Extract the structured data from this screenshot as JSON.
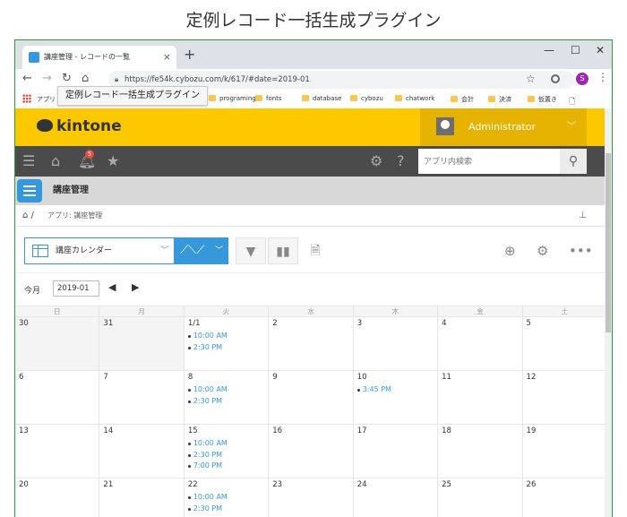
{
  "caption": "定例レコード一括生成プラグイン",
  "browser": {
    "tab_title": "講座管理 - レコードの一覧",
    "tab_close": "×",
    "new_tab": "+",
    "url": "https://fe54k.cybozu.com/k/617/#date=2019-01",
    "bookmarks": [
      "アプリ",
      "programing",
      "fonts",
      "database",
      "cybozu",
      "chatwork",
      "会計",
      "決済",
      "仮置き"
    ],
    "tooltip": "定例レコード一括生成プラグイン",
    "profile_initial": "S"
  },
  "header": {
    "logo": "kintone",
    "user": "Administrator"
  },
  "nav": {
    "notification_count": "5",
    "search_placeholder": "アプリ内検索"
  },
  "app": {
    "name": "講座管理",
    "breadcrumb": "アプリ: 講座管理"
  },
  "toolbar": {
    "view_name": "講座カレンダー"
  },
  "calendar": {
    "today_label": "今月",
    "month_value": "2019-01",
    "weekdays": [
      "日",
      "月",
      "火",
      "水",
      "木",
      "金",
      "土"
    ],
    "weeks": [
      [
        {
          "d": "30",
          "prev": true,
          "ev": []
        },
        {
          "d": "31",
          "prev": true,
          "ev": []
        },
        {
          "d": "1/1",
          "ev": [
            "10:00 AM",
            "2:30 PM"
          ]
        },
        {
          "d": "2",
          "ev": []
        },
        {
          "d": "3",
          "ev": []
        },
        {
          "d": "4",
          "ev": []
        },
        {
          "d": "5",
          "ev": []
        }
      ],
      [
        {
          "d": "6",
          "ev": []
        },
        {
          "d": "7",
          "ev": []
        },
        {
          "d": "8",
          "ev": [
            "10:00 AM",
            "2:30 PM"
          ]
        },
        {
          "d": "9",
          "ev": []
        },
        {
          "d": "10",
          "ev": [
            "3:45 PM"
          ]
        },
        {
          "d": "11",
          "ev": []
        },
        {
          "d": "12",
          "ev": []
        }
      ],
      [
        {
          "d": "13",
          "ev": []
        },
        {
          "d": "14",
          "ev": []
        },
        {
          "d": "15",
          "ev": [
            "10:00 AM",
            "2:30 PM",
            "7:00 PM"
          ]
        },
        {
          "d": "16",
          "ev": []
        },
        {
          "d": "17",
          "ev": []
        },
        {
          "d": "18",
          "ev": []
        },
        {
          "d": "19",
          "ev": []
        }
      ],
      [
        {
          "d": "20",
          "ev": []
        },
        {
          "d": "21",
          "ev": []
        },
        {
          "d": "22",
          "ev": [
            "10:00 AM",
            "2:30 PM"
          ]
        },
        {
          "d": "23",
          "ev": []
        },
        {
          "d": "24",
          "ev": []
        },
        {
          "d": "25",
          "ev": []
        },
        {
          "d": "26",
          "ev": []
        }
      ]
    ]
  },
  "colors": {
    "brand_yellow": "#fcc800",
    "accent_blue": "#3498db",
    "nav_dark": "#4b4b4b"
  }
}
